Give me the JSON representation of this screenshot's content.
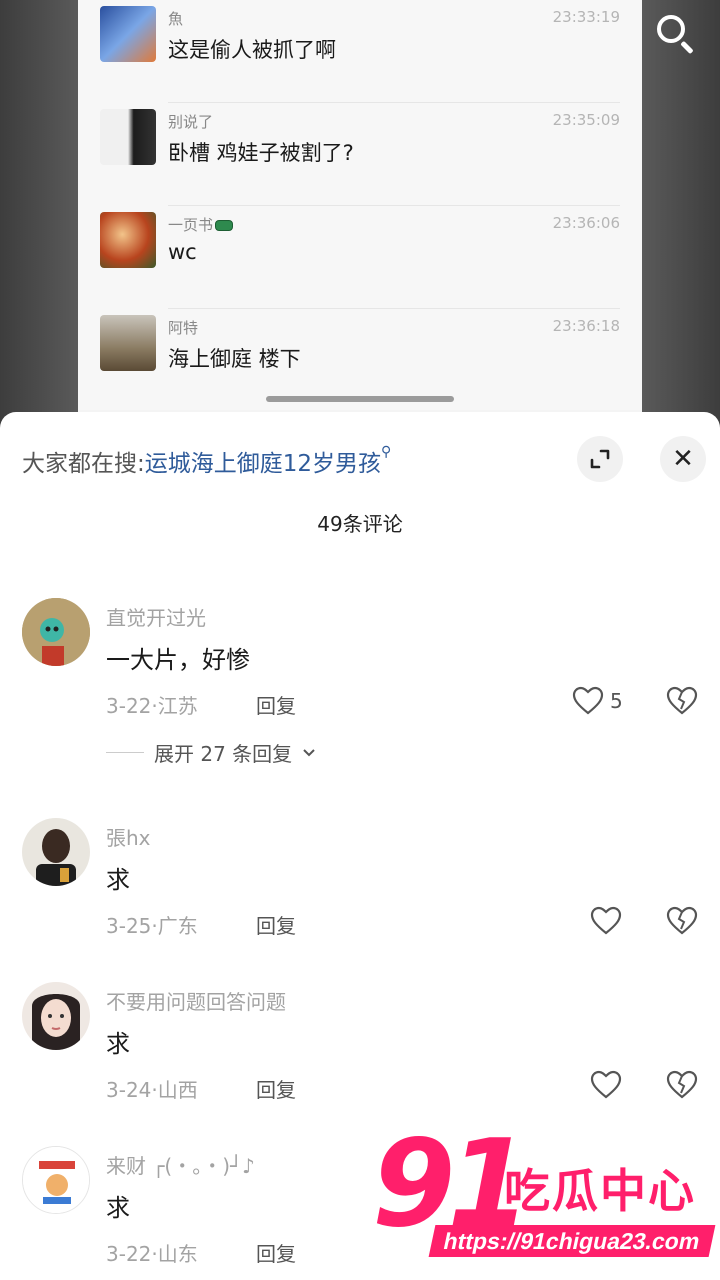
{
  "chat_screenshot": {
    "rows": [
      {
        "name": "魚",
        "time": "23:33:19",
        "message": "这是偷人被抓了啊"
      },
      {
        "name": "别说了",
        "time": "23:35:09",
        "message": "卧槽 鸡娃子被割了?"
      },
      {
        "name": "一页书",
        "time": "23:36:06",
        "message": "wc"
      },
      {
        "name": "阿特",
        "time": "23:36:18",
        "message": "海上御庭 楼下"
      }
    ]
  },
  "sheet": {
    "search_prefix": "大家都在搜:",
    "search_term": "运城海上御庭12岁男孩",
    "comment_count": "49条评论",
    "close_glyph": "✕"
  },
  "comments": [
    {
      "user": "直觉开过光",
      "text": "一大片，好惨",
      "meta": "3-22·江苏",
      "reply": "回复",
      "likes": "5",
      "expand": "展开 27 条回复"
    },
    {
      "user": "張hx",
      "text": "求",
      "meta": "3-25·广东",
      "reply": "回复",
      "likes": ""
    },
    {
      "user": "不要用问题回答问题",
      "text": "求",
      "meta": "3-24·山西",
      "reply": "回复",
      "likes": ""
    },
    {
      "user": "来财 ┌(・。・)┘♪",
      "text": "求",
      "meta": "3-22·山东",
      "reply": "回复",
      "likes": ""
    }
  ],
  "watermark": {
    "number": "91",
    "chinese": "吃瓜中心",
    "url": "https://91chigua23.com"
  },
  "colors": {
    "link_blue": "#2f5b9a",
    "watermark_pink": "#ff1f6b"
  },
  "icons": [
    "search-icon",
    "expand-icon",
    "close-icon",
    "heart-icon",
    "broken-heart-icon",
    "chevron-down-icon"
  ]
}
